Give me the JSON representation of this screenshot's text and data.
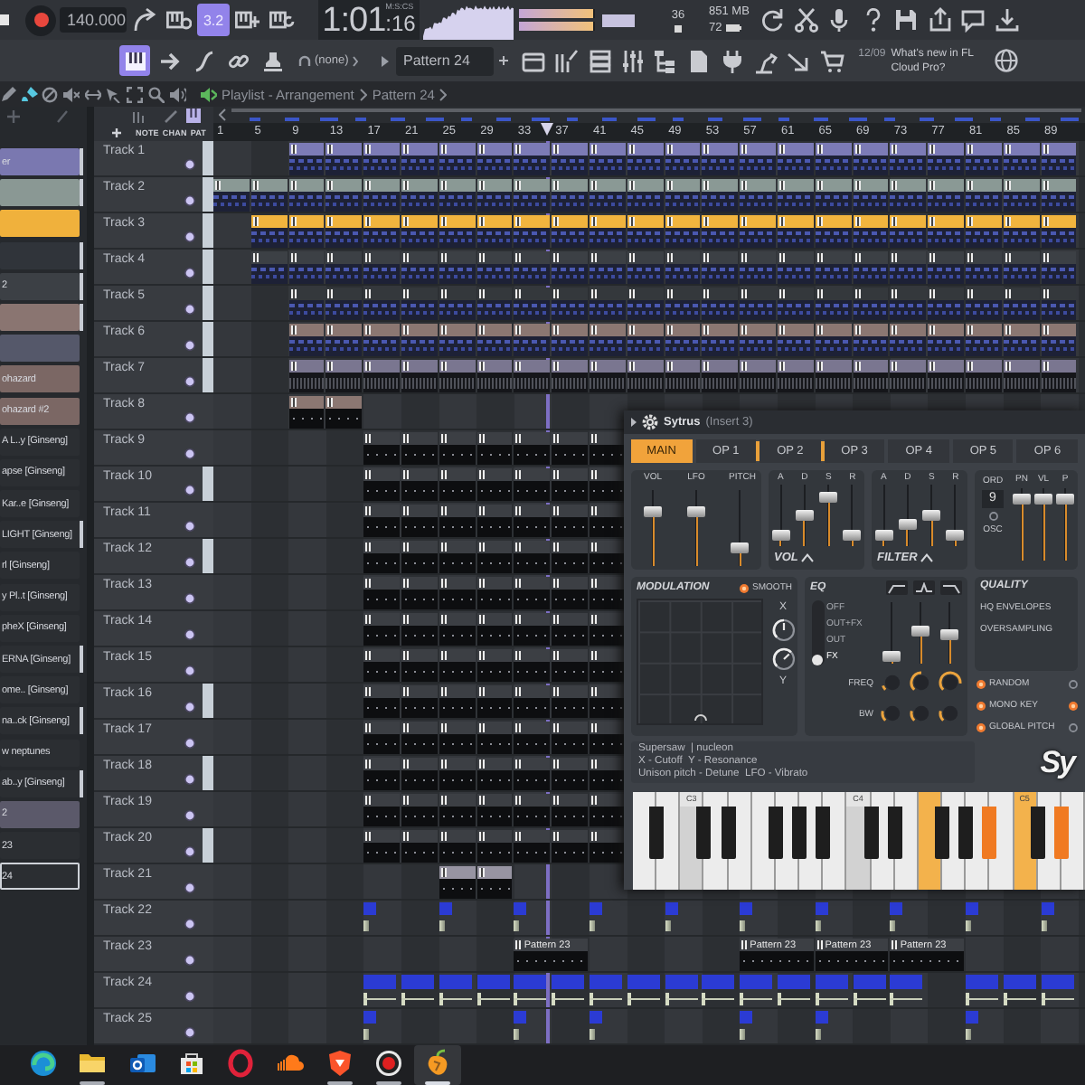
{
  "toolbar": {
    "tempo": "140.000",
    "mode_buttons": [
      {
        "selected": false
      },
      {
        "selected": false
      },
      {
        "label": "3.2",
        "selected": true
      },
      {
        "selected": false
      },
      {
        "selected": false
      }
    ],
    "time": "1:01",
    "time_fraction": ":16",
    "time_unit": "M:S:CS",
    "meters": [
      {
        "level": 0.97
      },
      {
        "level": 0.97
      }
    ],
    "cpu": "36",
    "memory": "851 MB",
    "polyphony": "72",
    "tool_buttons": [
      {
        "selected": true
      },
      {
        "selected": false
      },
      {
        "selected": false
      },
      {
        "selected": false
      },
      {
        "selected": false
      }
    ],
    "channel": "(none)",
    "pattern": "Pattern 24",
    "news_date": "12/09",
    "news": "What's new in FL Cloud Pro?"
  },
  "playlist": {
    "tools": [
      {
        "selected": false
      },
      {
        "selected": true
      },
      {
        "selected": false
      },
      {
        "selected": false
      },
      {
        "selected": false
      },
      {
        "selected": false
      },
      {
        "selected": false
      },
      {
        "selected": false
      },
      {
        "selected": false
      }
    ],
    "breadcrumb": [
      "Playlist - Arrangement",
      "Pattern 24"
    ],
    "column_labels": [
      "NOTE",
      "CHAN",
      "PAT"
    ],
    "ruler": [
      "1",
      "5",
      "9",
      "13",
      "17",
      "21",
      "25",
      "29",
      "33",
      "37",
      "41",
      "45",
      "49",
      "53",
      "57",
      "61",
      "65",
      "69",
      "73",
      "77",
      "81",
      "85",
      "89"
    ],
    "playhead": {
      "level": 0.384
    },
    "picker": [
      {
        "label": "er",
        "color": "#7a78b0",
        "marked": true,
        "selected": false
      },
      {
        "color": "#8a9894",
        "marked": true,
        "selected": false
      },
      {
        "color": "#f0b13c",
        "marked": false,
        "selected": false
      },
      {
        "color": "#30343a",
        "marked": true,
        "selected": false
      },
      {
        "label": "2",
        "color": "#3c4045",
        "marked": true,
        "selected": false
      },
      {
        "color": "#8a7571",
        "marked": true,
        "selected": false
      },
      {
        "color": "#55586a",
        "marked": false,
        "selected": false
      },
      {
        "label": "ohazard",
        "color": "#7b6764",
        "marked": false,
        "selected": false
      },
      {
        "label": "ohazard #2",
        "color": "#7b6764",
        "marked": false,
        "selected": false
      },
      {
        "label": "A L..y [Ginseng]",
        "color": "#2b2e32",
        "marked": false,
        "selected": false
      },
      {
        "label": "apse [Ginseng]",
        "color": "#2b2e32",
        "marked": false,
        "selected": false
      },
      {
        "label": "Kar..e [Ginseng]",
        "color": "#2b2e32",
        "marked": false,
        "selected": false
      },
      {
        "label": "LIGHT [Ginseng]",
        "color": "#2b2e32",
        "marked": true,
        "selected": false
      },
      {
        "label": "rl [Ginseng]",
        "color": "#2b2e32",
        "marked": false,
        "selected": false
      },
      {
        "label": "y Pl..t [Ginseng]",
        "color": "#2b2e32",
        "marked": false,
        "selected": false
      },
      {
        "label": "pheX [Ginseng]",
        "color": "#2b2e32",
        "marked": false,
        "selected": false
      },
      {
        "label": "ERNA [Ginseng]",
        "color": "#2b2e32",
        "marked": true,
        "selected": false
      },
      {
        "label": "ome.. [Ginseng]",
        "color": "#2b2e32",
        "marked": false,
        "selected": false
      },
      {
        "label": "na..ck [Ginseng]",
        "color": "#2b2e32",
        "marked": true,
        "selected": false
      },
      {
        "label": "w neptunes",
        "color": "#2b2e32",
        "marked": false,
        "selected": false
      },
      {
        "label": "ab..y [Ginseng]",
        "color": "#2b2e32",
        "marked": true,
        "selected": false
      },
      {
        "label": "2",
        "color": "#5b596a",
        "marked": false,
        "selected": false
      },
      {
        "label": "23",
        "color": "#2b2e32",
        "marked": false,
        "selected": false
      },
      {
        "label": "24",
        "color": "#2b2e32",
        "marked": false,
        "selected": true
      }
    ],
    "tracks": [
      {
        "name": "Track 1",
        "marked": true,
        "kind": "notes",
        "color": "#7c7bb6",
        "slots": [
          false,
          false,
          true,
          true,
          true,
          true,
          true,
          true,
          true,
          true,
          true,
          true,
          true,
          true,
          true,
          true,
          true,
          true,
          true,
          true,
          true,
          true,
          true
        ]
      },
      {
        "name": "Track 2",
        "marked": true,
        "kind": "notes",
        "color": "#8a9995",
        "slots": [
          true,
          true,
          true,
          true,
          true,
          true,
          true,
          true,
          true,
          true,
          true,
          true,
          true,
          true,
          true,
          true,
          true,
          true,
          true,
          true,
          true,
          true,
          true
        ]
      },
      {
        "name": "Track 3",
        "marked": true,
        "kind": "notes",
        "color": "#f1b43e",
        "slots": [
          false,
          true,
          true,
          true,
          true,
          true,
          true,
          true,
          true,
          true,
          true,
          true,
          true,
          true,
          true,
          true,
          true,
          true,
          true,
          true,
          true,
          true,
          true
        ]
      },
      {
        "name": "Track 4",
        "marked": true,
        "kind": "notes",
        "color": "#3c4045",
        "slots": [
          false,
          true,
          true,
          true,
          true,
          true,
          true,
          true,
          true,
          true,
          true,
          true,
          true,
          true,
          true,
          true,
          true,
          true,
          true,
          true,
          true,
          true,
          true
        ]
      },
      {
        "name": "Track 5",
        "marked": true,
        "kind": "notes",
        "color": "#34383c",
        "slots": [
          false,
          false,
          true,
          true,
          true,
          true,
          true,
          true,
          true,
          true,
          true,
          true,
          true,
          true,
          true,
          true,
          true,
          true,
          true,
          true,
          true,
          true,
          true
        ]
      },
      {
        "name": "Track 6",
        "marked": true,
        "kind": "notes",
        "color": "#8b7772",
        "slots": [
          false,
          false,
          true,
          true,
          true,
          true,
          true,
          true,
          true,
          true,
          true,
          true,
          true,
          true,
          true,
          true,
          true,
          true,
          true,
          true,
          true,
          true,
          true
        ]
      },
      {
        "name": "Track 7",
        "marked": true,
        "kind": "audio",
        "color": "#7a7690",
        "slots": [
          false,
          false,
          true,
          true,
          true,
          true,
          true,
          true,
          true,
          true,
          true,
          true,
          true,
          true,
          true,
          true,
          true,
          true,
          true,
          true,
          true,
          true,
          true
        ]
      },
      {
        "name": "Track 8",
        "marked": false,
        "kind": "sparse",
        "color": "#8b7772",
        "slots": [
          false,
          false,
          true,
          true,
          false,
          false,
          false,
          false,
          false,
          false,
          false,
          false,
          false,
          false,
          false,
          false,
          false,
          false,
          false,
          false,
          false,
          false,
          false
        ]
      },
      {
        "name": "Track 9",
        "marked": false,
        "kind": "sparse",
        "color": "#3c3f44",
        "slots": [
          false,
          false,
          false,
          false,
          true,
          true,
          true,
          true,
          true,
          true,
          true,
          false,
          false,
          false,
          false,
          false,
          false,
          false,
          false,
          false,
          false,
          false,
          false
        ]
      },
      {
        "name": "Track 10",
        "marked": true,
        "kind": "sparse",
        "color": "#3c3f44",
        "slots": [
          false,
          false,
          false,
          false,
          true,
          true,
          true,
          true,
          true,
          true,
          true,
          false,
          false,
          false,
          false,
          false,
          false,
          false,
          false,
          false,
          false,
          false,
          false
        ]
      },
      {
        "name": "Track 11",
        "marked": false,
        "kind": "sparse",
        "color": "#3c3f44",
        "slots": [
          false,
          false,
          false,
          false,
          true,
          true,
          true,
          true,
          true,
          true,
          true,
          false,
          false,
          false,
          false,
          false,
          false,
          false,
          false,
          false,
          false,
          false,
          false
        ]
      },
      {
        "name": "Track 12",
        "marked": true,
        "kind": "sparse",
        "color": "#3c3f44",
        "slots": [
          false,
          false,
          false,
          false,
          true,
          true,
          true,
          true,
          true,
          true,
          true,
          false,
          false,
          false,
          false,
          false,
          false,
          false,
          false,
          false,
          false,
          false,
          false
        ]
      },
      {
        "name": "Track 13",
        "marked": false,
        "kind": "sparse",
        "color": "#3c3f44",
        "slots": [
          false,
          false,
          false,
          false,
          true,
          true,
          true,
          true,
          true,
          true,
          true,
          false,
          false,
          false,
          false,
          false,
          false,
          false,
          false,
          false,
          false,
          false,
          false
        ]
      },
      {
        "name": "Track 14",
        "marked": false,
        "kind": "sparse",
        "color": "#3c3f44",
        "slots": [
          false,
          false,
          false,
          false,
          true,
          true,
          true,
          true,
          true,
          true,
          true,
          false,
          false,
          false,
          false,
          false,
          false,
          false,
          false,
          false,
          false,
          false,
          false
        ]
      },
      {
        "name": "Track 15",
        "marked": false,
        "kind": "sparse",
        "color": "#3c3f44",
        "slots": [
          false,
          false,
          false,
          false,
          true,
          true,
          true,
          true,
          true,
          true,
          true,
          false,
          false,
          false,
          false,
          false,
          false,
          false,
          false,
          false,
          false,
          false,
          false
        ]
      },
      {
        "name": "Track 16",
        "marked": true,
        "kind": "sparse",
        "color": "#3c3f44",
        "slots": [
          false,
          false,
          false,
          false,
          true,
          true,
          true,
          true,
          true,
          true,
          true,
          false,
          false,
          false,
          false,
          false,
          false,
          false,
          false,
          false,
          false,
          false,
          false
        ]
      },
      {
        "name": "Track 17",
        "marked": false,
        "kind": "sparse",
        "color": "#3c3f44",
        "slots": [
          false,
          false,
          false,
          false,
          true,
          true,
          true,
          true,
          true,
          true,
          true,
          false,
          false,
          false,
          false,
          false,
          false,
          false,
          false,
          false,
          false,
          false,
          false
        ]
      },
      {
        "name": "Track 18",
        "marked": true,
        "kind": "sparse",
        "color": "#3c3f44",
        "slots": [
          false,
          false,
          false,
          false,
          true,
          true,
          true,
          true,
          true,
          true,
          true,
          false,
          false,
          false,
          false,
          false,
          false,
          false,
          false,
          false,
          false,
          false,
          false
        ]
      },
      {
        "name": "Track 19",
        "marked": false,
        "kind": "sparse",
        "color": "#3c3f44",
        "slots": [
          false,
          false,
          false,
          false,
          true,
          true,
          true,
          true,
          true,
          true,
          true,
          false,
          false,
          false,
          false,
          false,
          false,
          false,
          false,
          false,
          false,
          false,
          false
        ]
      },
      {
        "name": "Track 20",
        "marked": true,
        "kind": "sparse",
        "color": "#3c3f44",
        "slots": [
          false,
          false,
          false,
          false,
          true,
          true,
          true,
          true,
          true,
          true,
          true,
          false,
          false,
          false,
          false,
          false,
          false,
          false,
          false,
          false,
          false,
          false,
          false
        ]
      },
      {
        "name": "Track 21",
        "marked": false,
        "kind": "sparse",
        "color": "#9794a2",
        "slots": [
          false,
          false,
          false,
          false,
          false,
          false,
          true,
          true,
          false,
          false,
          false,
          false,
          false,
          false,
          false,
          false,
          false,
          false,
          false,
          false,
          false,
          false,
          false
        ]
      },
      {
        "name": "Track 22",
        "marked": false,
        "kind": "hit",
        "color": "#2b3bd4",
        "slots": [
          false,
          false,
          false,
          false,
          true,
          false,
          true,
          false,
          true,
          false,
          true,
          false,
          true,
          false,
          true,
          false,
          true,
          false,
          true,
          false,
          true,
          false,
          true
        ]
      },
      {
        "name": "Track 23",
        "marked": false,
        "kind": "labeled",
        "color": "#3c3f44",
        "slots": [
          false,
          false,
          false,
          false,
          false,
          false,
          false,
          false,
          true,
          false,
          false,
          false,
          false,
          false,
          true,
          false,
          true,
          false,
          true,
          false,
          false,
          false,
          false
        ],
        "labels": [
          "Pattern 23",
          "Pattern 23",
          "Pattern 23",
          "Pattern 23"
        ]
      },
      {
        "name": "Track 24",
        "marked": false,
        "kind": "block",
        "color": "#2b3bd4",
        "slots": [
          false,
          false,
          false,
          false,
          true,
          true,
          true,
          true,
          true,
          true,
          true,
          true,
          true,
          true,
          true,
          true,
          true,
          true,
          true,
          false,
          true,
          true,
          true
        ]
      },
      {
        "name": "Track 25",
        "marked": false,
        "kind": "hit",
        "color": "#2b3bd4",
        "slots": [
          false,
          false,
          false,
          false,
          true,
          false,
          false,
          false,
          true,
          false,
          true,
          false,
          false,
          false,
          true,
          false,
          true,
          false,
          false,
          false,
          true,
          false,
          false
        ]
      }
    ]
  },
  "plugin": {
    "title": "Sytrus",
    "subtitle": "(Insert 3)",
    "tabs": [
      {
        "label": "MAIN",
        "selected": true,
        "active": false
      },
      {
        "label": "OP 1",
        "selected": false,
        "active": true
      },
      {
        "label": "OP 2",
        "selected": false,
        "active": true
      },
      {
        "label": "OP 3",
        "selected": false,
        "active": false
      },
      {
        "label": "OP 4",
        "selected": false,
        "active": false
      },
      {
        "label": "OP 5",
        "selected": false,
        "active": false
      },
      {
        "label": "OP 6",
        "selected": false,
        "active": false
      }
    ],
    "mixer": [
      {
        "label": "VOL",
        "level": 0.75
      },
      {
        "label": "LFO",
        "level": 0.75
      },
      {
        "label": "PITCH",
        "level": 0.2
      }
    ],
    "envelopes": [
      {
        "label": "VOL",
        "sliders": [
          {
            "label": "A",
            "level": 0.1
          },
          {
            "label": "D",
            "level": 0.5
          },
          {
            "label": "S",
            "level": 0.85
          },
          {
            "label": "R",
            "level": 0.12
          }
        ]
      },
      {
        "label": "FILTER",
        "sliders": [
          {
            "label": "A",
            "level": 0.1
          },
          {
            "label": "D",
            "level": 0.32
          },
          {
            "label": "S",
            "level": 0.5
          },
          {
            "label": "R",
            "level": 0.1
          }
        ]
      }
    ],
    "oscillator": {
      "order_label": "ORD",
      "order": "9",
      "osc_label": "OSC",
      "osc_on": false,
      "sliders": [
        {
          "label": "PN",
          "level": 0.9
        },
        {
          "label": "VL",
          "level": 0.9
        },
        {
          "label": "P",
          "level": 0.9
        }
      ]
    },
    "modulation": {
      "title": "MODULATION",
      "smooth": {
        "label": "SMOOTH",
        "on": true
      },
      "x_label": "X",
      "y_label": "Y",
      "x_knob": {
        "level": 0.5
      },
      "y_knob": {
        "level": 0.67
      }
    },
    "eq": {
      "title": "EQ",
      "modes": [
        {
          "label": "OFF",
          "selected": false
        },
        {
          "label": "OUT+FX",
          "selected": false
        },
        {
          "label": "OUT",
          "selected": false
        },
        {
          "label": "FX",
          "selected": true
        }
      ],
      "sliders": [
        {
          "level": 0.05
        },
        {
          "level": 0.55
        },
        {
          "level": 0.45
        }
      ],
      "freq_label": "FREQ",
      "freq_knobs": [
        {
          "level": 0.1
        },
        {
          "level": 0.5
        },
        {
          "level": 0.85
        }
      ],
      "bw_label": "BW",
      "bw_knobs": [
        {
          "level": 0.22
        },
        {
          "level": 0.22
        },
        {
          "level": 0.22
        }
      ]
    },
    "quality": {
      "title": "QUALITY",
      "items": [
        "HQ ENVELOPES",
        "OVERSAMPLING"
      ]
    },
    "options": [
      {
        "label": "RANDOM",
        "on": true
      },
      {
        "label": "MONO KEY",
        "on": true
      },
      {
        "label": "GLOBAL PITCH",
        "on": true
      }
    ],
    "side_options": [
      {
        "on": false
      },
      {
        "on": true
      },
      {
        "on": false
      }
    ],
    "info": [
      "Supersaw  | nucleon",
      "X - Cutoff  Y - Resonance",
      "Unison pitch - Detune  LFO - Vibrato"
    ],
    "logo": "Sy",
    "keys": [
      {
        "kind": "white",
        "pressed": false
      },
      {
        "kind": "black",
        "pressed": false
      },
      {
        "kind": "white",
        "pressed": false
      },
      {
        "kind": "white",
        "pressed": false,
        "label": "C3"
      },
      {
        "kind": "black",
        "pressed": false
      },
      {
        "kind": "white",
        "pressed": false
      },
      {
        "kind": "black",
        "pressed": false
      },
      {
        "kind": "white",
        "pressed": false
      },
      {
        "kind": "white",
        "pressed": false
      },
      {
        "kind": "black",
        "pressed": false
      },
      {
        "kind": "white",
        "pressed": false
      },
      {
        "kind": "black",
        "pressed": false
      },
      {
        "kind": "white",
        "pressed": false
      },
      {
        "kind": "black",
        "pressed": false
      },
      {
        "kind": "white",
        "pressed": false
      },
      {
        "kind": "white",
        "pressed": false,
        "label": "C4"
      },
      {
        "kind": "black",
        "pressed": false
      },
      {
        "kind": "white",
        "pressed": false
      },
      {
        "kind": "black",
        "pressed": false
      },
      {
        "kind": "white",
        "pressed": false
      },
      {
        "kind": "white",
        "pressed": true
      },
      {
        "kind": "black",
        "pressed": false
      },
      {
        "kind": "white",
        "pressed": false
      },
      {
        "kind": "black",
        "pressed": false
      },
      {
        "kind": "white",
        "pressed": false
      },
      {
        "kind": "black",
        "pressed": true
      },
      {
        "kind": "white",
        "pressed": false
      },
      {
        "kind": "white",
        "pressed": true,
        "label": "C5"
      },
      {
        "kind": "black",
        "pressed": false
      },
      {
        "kind": "white",
        "pressed": false
      },
      {
        "kind": "black",
        "pressed": true
      },
      {
        "kind": "white",
        "pressed": false
      }
    ]
  },
  "taskbar": {
    "apps": [
      {
        "running": false,
        "selected": false
      },
      {
        "running": true,
        "selected": false
      },
      {
        "running": false,
        "selected": false
      },
      {
        "running": false,
        "selected": false
      },
      {
        "running": false,
        "selected": false
      },
      {
        "running": false,
        "selected": false
      },
      {
        "running": true,
        "selected": false
      },
      {
        "running": true,
        "selected": false
      },
      {
        "running": true,
        "selected": true
      }
    ]
  }
}
